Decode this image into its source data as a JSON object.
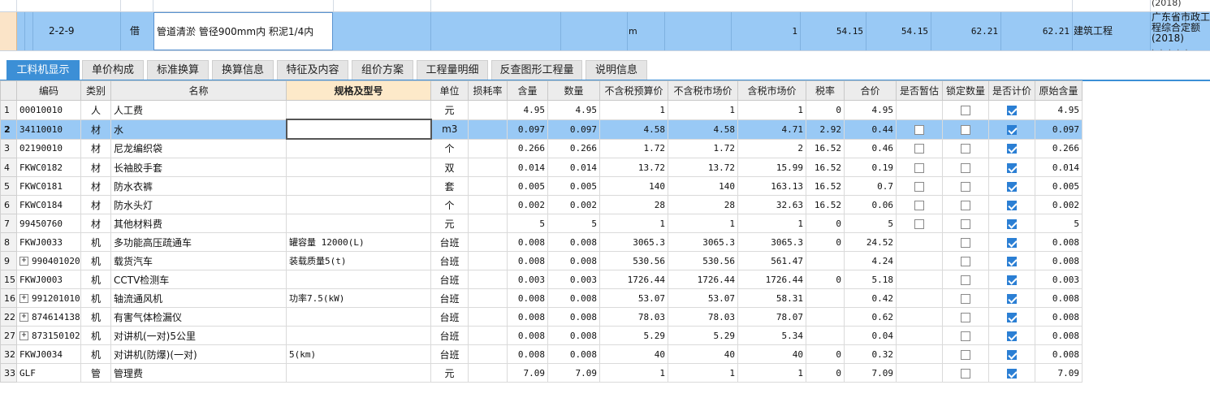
{
  "top": {
    "prev_row_text": "(2018)",
    "row_code": "2-2-9",
    "row_type": "借",
    "row_name": "管道清淤 管径900mm内 积泥1/4内",
    "row_unit": "m",
    "row_qty": "1",
    "row_v1": "54.15",
    "row_v2": "54.15",
    "row_v3": "62.21",
    "row_v4": "62.21",
    "row_category": "建筑工程",
    "row_quota": "广东省市政工程综合定额(2018)",
    "dots": "· · · · ·"
  },
  "tabs": [
    {
      "label": "工料机显示",
      "active": true
    },
    {
      "label": "单价构成",
      "active": false
    },
    {
      "label": "标准换算",
      "active": false
    },
    {
      "label": "换算信息",
      "active": false
    },
    {
      "label": "特征及内容",
      "active": false
    },
    {
      "label": "组价方案",
      "active": false
    },
    {
      "label": "工程量明细",
      "active": false
    },
    {
      "label": "反查图形工程量",
      "active": false
    },
    {
      "label": "说明信息",
      "active": false
    }
  ],
  "table": {
    "headers": {
      "rownum": "",
      "code": "编码",
      "type": "类别",
      "name": "名称",
      "spec": "规格及型号",
      "unit": "单位",
      "loss": "损耗率",
      "content": "含量",
      "qty": "数量",
      "budget_price": "不含税预算价",
      "market_price": "不含税市场价",
      "tax_market_price": "含税市场价",
      "tax_rate": "税率",
      "total": "合价",
      "provisional": "是否暂估",
      "lock_qty": "锁定数量",
      "priced": "是否计价",
      "orig_content": "原始含量"
    },
    "rows": [
      {
        "no": "1",
        "expand": false,
        "code": "00010010",
        "type": "人",
        "name": "人工费",
        "spec": "",
        "unit": "元",
        "loss": "",
        "content": "4.95",
        "qty": "4.95",
        "budget": "1",
        "market": "1",
        "tax_market": "1",
        "rate": "0",
        "total": "4.95",
        "prov": null,
        "lock": false,
        "priced": true,
        "orig": "4.95"
      },
      {
        "no": "2",
        "expand": false,
        "code": "34110010",
        "type": "材",
        "name": "水",
        "spec": "",
        "unit": "m3",
        "loss": "",
        "content": "0.097",
        "qty": "0.097",
        "budget": "4.58",
        "market": "4.58",
        "tax_market": "4.71",
        "rate": "2.92",
        "total": "0.44",
        "prov": false,
        "lock": false,
        "priced": true,
        "orig": "0.097",
        "selected": true
      },
      {
        "no": "3",
        "expand": false,
        "code": "02190010",
        "type": "材",
        "name": "尼龙编织袋",
        "spec": "",
        "unit": "个",
        "loss": "",
        "content": "0.266",
        "qty": "0.266",
        "budget": "1.72",
        "market": "1.72",
        "tax_market": "2",
        "rate": "16.52",
        "total": "0.46",
        "prov": false,
        "lock": false,
        "priced": true,
        "orig": "0.266"
      },
      {
        "no": "4",
        "expand": false,
        "code": "FKWC0182",
        "type": "材",
        "name": "长袖胶手套",
        "spec": "",
        "unit": "双",
        "loss": "",
        "content": "0.014",
        "qty": "0.014",
        "budget": "13.72",
        "market": "13.72",
        "tax_market": "15.99",
        "rate": "16.52",
        "total": "0.19",
        "prov": false,
        "lock": false,
        "priced": true,
        "orig": "0.014"
      },
      {
        "no": "5",
        "expand": false,
        "code": "FKWC0181",
        "type": "材",
        "name": "防水衣裤",
        "spec": "",
        "unit": "套",
        "loss": "",
        "content": "0.005",
        "qty": "0.005",
        "budget": "140",
        "market": "140",
        "tax_market": "163.13",
        "rate": "16.52",
        "total": "0.7",
        "prov": false,
        "lock": false,
        "priced": true,
        "orig": "0.005"
      },
      {
        "no": "6",
        "expand": false,
        "code": "FKWC0184",
        "type": "材",
        "name": "防水头灯",
        "spec": "",
        "unit": "个",
        "loss": "",
        "content": "0.002",
        "qty": "0.002",
        "budget": "28",
        "market": "28",
        "tax_market": "32.63",
        "rate": "16.52",
        "total": "0.06",
        "prov": false,
        "lock": false,
        "priced": true,
        "orig": "0.002"
      },
      {
        "no": "7",
        "expand": false,
        "code": "99450760",
        "type": "材",
        "name": "其他材料费",
        "spec": "",
        "unit": "元",
        "loss": "",
        "content": "5",
        "qty": "5",
        "budget": "1",
        "market": "1",
        "tax_market": "1",
        "rate": "0",
        "total": "5",
        "prov": false,
        "lock": false,
        "priced": true,
        "orig": "5"
      },
      {
        "no": "8",
        "expand": false,
        "code": "FKWJ0033",
        "type": "机",
        "name": "多功能高压疏通车",
        "spec": "罐容量 12000(L)",
        "unit": "台班",
        "loss": "",
        "content": "0.008",
        "qty": "0.008",
        "budget": "3065.3",
        "market": "3065.3",
        "tax_market": "3065.3",
        "rate": "0",
        "total": "24.52",
        "prov": null,
        "lock": false,
        "priced": true,
        "orig": "0.008"
      },
      {
        "no": "9",
        "expand": true,
        "code": "990401020",
        "type": "机",
        "name": "载货汽车",
        "spec": "装载质量5(t)",
        "unit": "台班",
        "loss": "",
        "content": "0.008",
        "qty": "0.008",
        "budget": "530.56",
        "market": "530.56",
        "tax_market": "561.47",
        "rate": "",
        "total": "4.24",
        "prov": null,
        "lock": false,
        "priced": true,
        "orig": "0.008"
      },
      {
        "no": "15",
        "expand": false,
        "code": "FKWJ0003",
        "type": "机",
        "name": "CCTV检测车",
        "spec": "",
        "unit": "台班",
        "loss": "",
        "content": "0.003",
        "qty": "0.003",
        "budget": "1726.44",
        "market": "1726.44",
        "tax_market": "1726.44",
        "rate": "0",
        "total": "5.18",
        "prov": null,
        "lock": false,
        "priced": true,
        "orig": "0.003"
      },
      {
        "no": "16",
        "expand": true,
        "code": "991201010",
        "type": "机",
        "name": "轴流通风机",
        "spec": "功率7.5(kW)",
        "unit": "台班",
        "loss": "",
        "content": "0.008",
        "qty": "0.008",
        "budget": "53.07",
        "market": "53.07",
        "tax_market": "58.31",
        "rate": "",
        "total": "0.42",
        "prov": null,
        "lock": false,
        "priced": true,
        "orig": "0.008"
      },
      {
        "no": "22",
        "expand": true,
        "code": "874614138",
        "type": "机",
        "name": "有害气体检漏仪",
        "spec": "",
        "unit": "台班",
        "loss": "",
        "content": "0.008",
        "qty": "0.008",
        "budget": "78.03",
        "market": "78.03",
        "tax_market": "78.07",
        "rate": "",
        "total": "0.62",
        "prov": null,
        "lock": false,
        "priced": true,
        "orig": "0.008"
      },
      {
        "no": "27",
        "expand": true,
        "code": "873150102",
        "type": "机",
        "name": "对讲机(一对)5公里",
        "spec": "",
        "unit": "台班",
        "loss": "",
        "content": "0.008",
        "qty": "0.008",
        "budget": "5.29",
        "market": "5.29",
        "tax_market": "5.34",
        "rate": "",
        "total": "0.04",
        "prov": null,
        "lock": false,
        "priced": true,
        "orig": "0.008"
      },
      {
        "no": "32",
        "expand": false,
        "code": "FKWJ0034",
        "type": "机",
        "name": "对讲机(防爆)(一对)",
        "spec": "5(km)",
        "unit": "台班",
        "loss": "",
        "content": "0.008",
        "qty": "0.008",
        "budget": "40",
        "market": "40",
        "tax_market": "40",
        "rate": "0",
        "total": "0.32",
        "prov": null,
        "lock": false,
        "priced": true,
        "orig": "0.008"
      },
      {
        "no": "33",
        "expand": false,
        "code": "GLF",
        "type": "管",
        "name": "管理费",
        "spec": "",
        "unit": "元",
        "loss": "",
        "content": "7.09",
        "qty": "7.09",
        "budget": "1",
        "market": "1",
        "tax_market": "1",
        "rate": "0",
        "total": "7.09",
        "prov": null,
        "lock": false,
        "priced": true,
        "orig": "7.09"
      }
    ]
  }
}
